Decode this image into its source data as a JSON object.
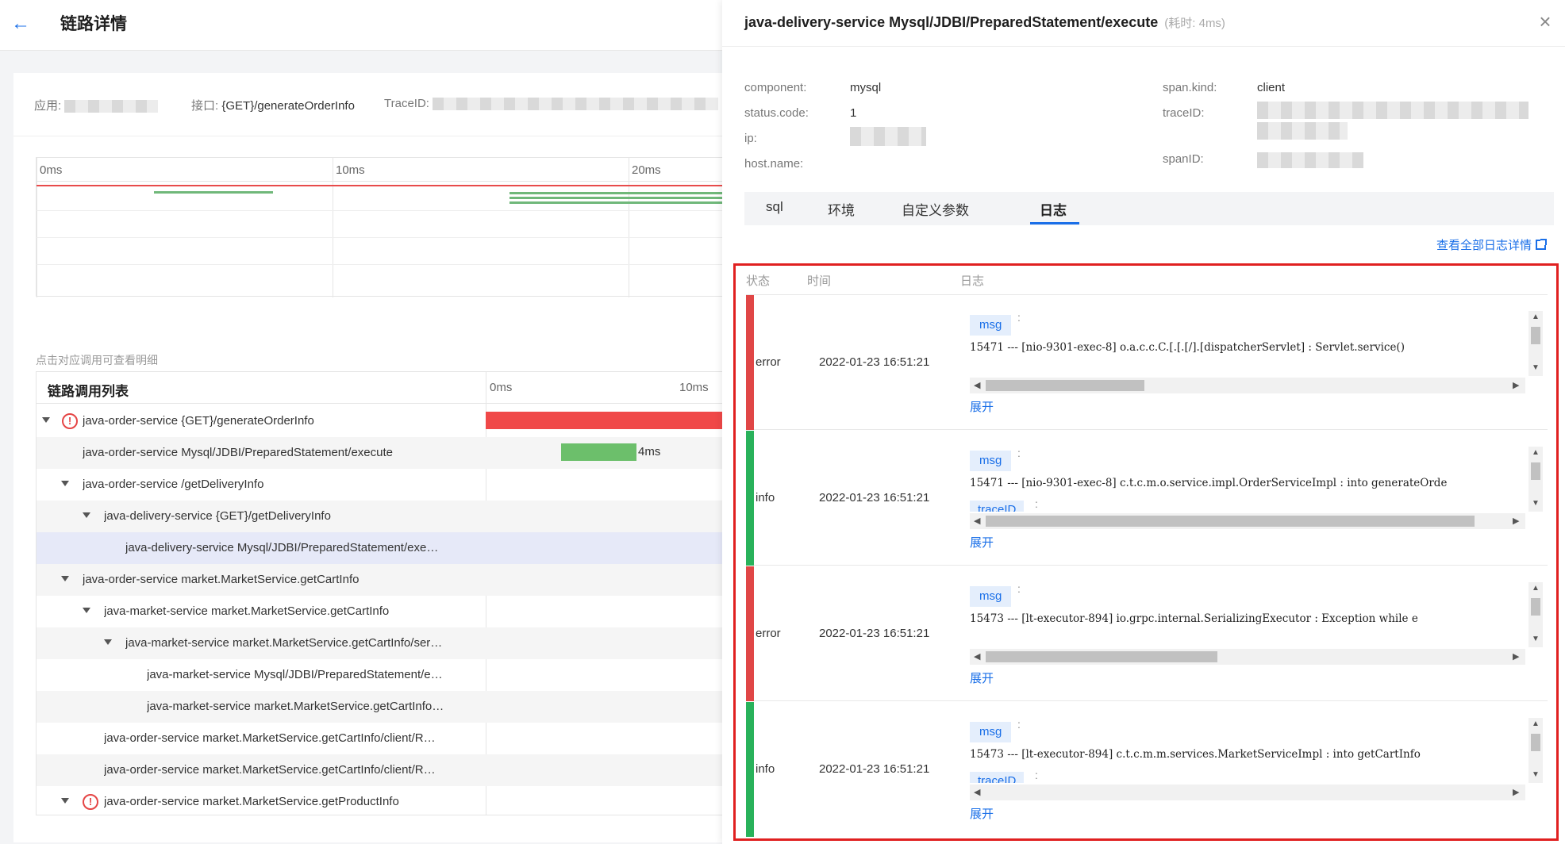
{
  "header": {
    "title": "链路详情"
  },
  "info": {
    "app_label": "应用:",
    "api_label": "接口:",
    "api_value": "{GET}/generateOrderInfo",
    "traceid_label": "TraceID:"
  },
  "timeline": {
    "ticks": [
      "0ms",
      "10ms",
      "20ms"
    ]
  },
  "hint": "点击对应调用可查看明细",
  "trace_list": {
    "title": "链路调用列表",
    "ticks": [
      "0ms",
      "10ms"
    ],
    "rows": [
      {
        "name": "java-order-service {GET}/generateOrderInfo"
      },
      {
        "name": "java-order-service Mysql/JDBI/PreparedStatement/execute",
        "bar_label": "4ms"
      },
      {
        "name": "java-order-service /getDeliveryInfo"
      },
      {
        "name": "java-delivery-service {GET}/getDeliveryInfo"
      },
      {
        "name": "java-delivery-service Mysql/JDBI/PreparedStatement/exe…"
      },
      {
        "name": "java-order-service market.MarketService.getCartInfo"
      },
      {
        "name": "java-market-service market.MarketService.getCartInfo"
      },
      {
        "name": "java-market-service market.MarketService.getCartInfo/ser…"
      },
      {
        "name": "java-market-service Mysql/JDBI/PreparedStatement/e…"
      },
      {
        "name": "java-market-service market.MarketService.getCartInfo…"
      },
      {
        "name": "java-order-service market.MarketService.getCartInfo/client/R…"
      },
      {
        "name": "java-order-service market.MarketService.getCartInfo/client/R…"
      },
      {
        "name": "java-order-service market.MarketService.getProductInfo"
      }
    ]
  },
  "drawer": {
    "title": "java-delivery-service Mysql/JDBI/PreparedStatement/execute",
    "subtitle": "(耗时: 4ms)",
    "attrs": {
      "component_label": "component:",
      "component_value": "mysql",
      "status_label": "status.code:",
      "status_value": "1",
      "ip_label": "ip:",
      "host_label": "host.name:",
      "kind_label": "span.kind:",
      "kind_value": "client",
      "traceid_label": "traceID:",
      "spanid_label": "spanID:"
    },
    "tabs": [
      "sql",
      "环境",
      "自定义参数",
      "日志"
    ],
    "active_tab": "日志",
    "view_all": "查看全部日志详情",
    "log_headers": [
      "状态",
      "时间",
      "日志"
    ],
    "logs": [
      {
        "status": "error",
        "time": "2022-01-23 16:51:21",
        "tag": "msg",
        "line": "15471 --- [nio-9301-exec-8] o.a.c.c.C.[.[.[/].[dispatcherServlet]     : Servlet.service()",
        "extra_tag": "",
        "expand": "展开",
        "color": "#e04646"
      },
      {
        "status": "info",
        "time": "2022-01-23 16:51:21",
        "tag": "msg",
        "line": "15471 --- [nio-9301-exec-8] c.t.c.m.o.service.impl.OrderServiceImpl   : into generateOrde",
        "extra_tag": "traceID",
        "expand": "展开",
        "color": "#29b25b"
      },
      {
        "status": "error",
        "time": "2022-01-23 16:51:21",
        "tag": "msg",
        "line": "15473 --- [lt-executor-894] io.grpc.internal.SerializingExecutor      : Exception while e",
        "extra_tag": "",
        "expand": "展开",
        "color": "#e04646"
      },
      {
        "status": "info",
        "time": "2022-01-23 16:51:21",
        "tag": "msg",
        "line": "15473 --- [lt-executor-894] c.t.c.m.m.services.MarketServiceImpl      : into getCartInfo",
        "extra_tag": "traceID",
        "expand": "展开",
        "color": "#29b25b"
      }
    ]
  },
  "colors": {
    "accent": "#1a6fe8",
    "error": "#e04646",
    "info": "#29b25b",
    "bar_error": "#f04848",
    "bar_ok": "#6cbf6b",
    "highlight_border": "#e02020"
  }
}
